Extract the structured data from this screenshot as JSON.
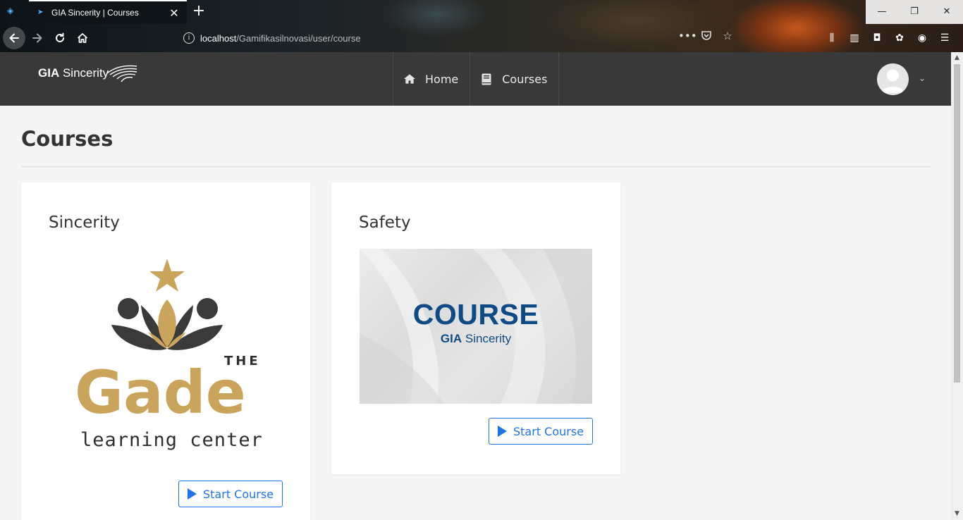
{
  "browser": {
    "tab_title": "GIA Sincerity | Courses",
    "new_tab": "+",
    "close_tab": "✕",
    "url_host": "localhost",
    "url_path": "/Gamifikasilnovasi/user/course",
    "page_actions": "•••"
  },
  "header": {
    "brand_bold": "GIA",
    "brand_rest": " Sincerity",
    "nav": [
      {
        "label": "Home",
        "icon": "home-icon"
      },
      {
        "label": "Courses",
        "icon": "book-icon"
      }
    ],
    "caret": "⌄"
  },
  "page": {
    "title": "Courses"
  },
  "courses": [
    {
      "title": "Sincerity",
      "image_text": {
        "the": "THE",
        "brand": "Gade",
        "tagline": "learning center"
      },
      "button_label": "Start Course"
    },
    {
      "title": "Safety",
      "image_text": {
        "title": "COURSE",
        "sub_bold": "GIA",
        "sub_rest": " Sincerity"
      },
      "button_label": "Start Course"
    }
  ],
  "colors": {
    "accent": "#1e74e8",
    "header_bg": "#393939",
    "gold": "#c9a45a",
    "dark": "#3a3a3a",
    "banner_blue": "#0e4a86"
  }
}
